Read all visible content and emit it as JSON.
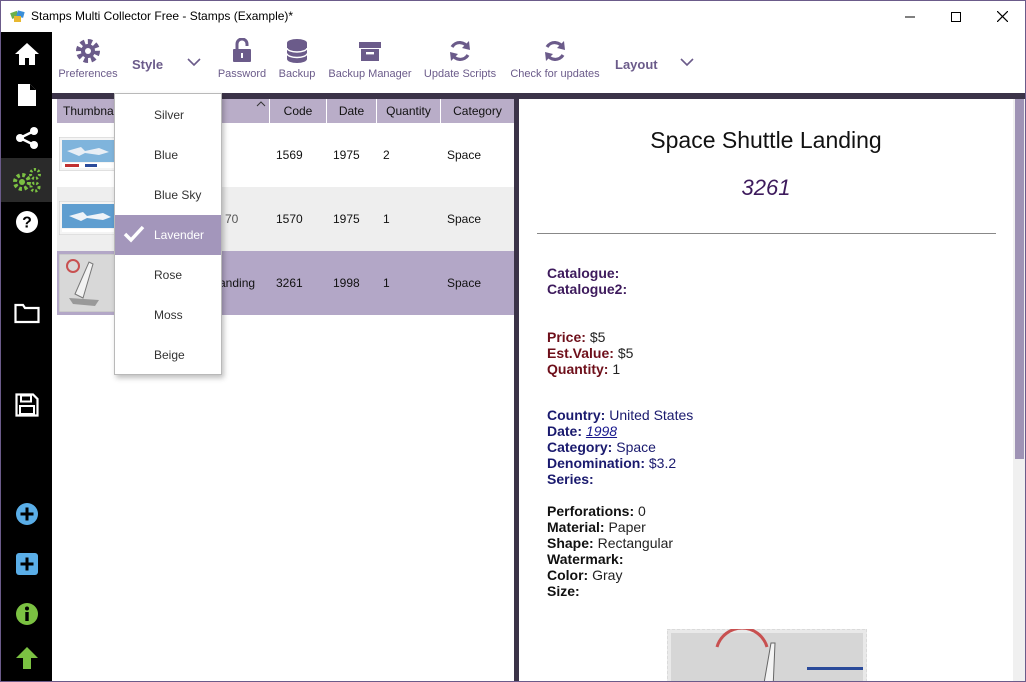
{
  "window": {
    "title": "Stamps Multi Collector Free - Stamps (Example)*"
  },
  "toolbar": {
    "preferences": "Preferences",
    "style": "Style",
    "password": "Password",
    "backup": "Backup",
    "backup_manager": "Backup Manager",
    "update_scripts": "Update Scripts",
    "check_updates": "Check for updates",
    "layout": "Layout"
  },
  "sidebar": {
    "items": [
      "home-icon",
      "document-icon",
      "share-icon",
      "settings-icon",
      "help-icon",
      "folder-icon",
      "save-icon",
      "add-circle-icon",
      "add-square-icon",
      "info-icon",
      "up-arrow-icon"
    ]
  },
  "grid": {
    "columns": [
      "Thumbna",
      "Code",
      "Date",
      "Quantity",
      "Category"
    ],
    "rows": [
      {
        "name": "",
        "code": "1569",
        "date": "1975",
        "quantity": "2",
        "category": "Space"
      },
      {
        "name": "70",
        "code": "1570",
        "date": "1975",
        "quantity": "1",
        "category": "Space"
      },
      {
        "name": "anding",
        "code": "3261",
        "date": "1998",
        "quantity": "1",
        "category": "Space"
      }
    ]
  },
  "style_menu": {
    "items": [
      "Silver",
      "Blue",
      "Blue Sky",
      "Lavender",
      "Rose",
      "Moss",
      "Beige"
    ],
    "selected": "Lavender"
  },
  "detail": {
    "title": "Space Shuttle Landing",
    "code": "3261",
    "catalogue_label": "Catalogue:",
    "catalogue2_label": "Catalogue2:",
    "price_label": "Price:",
    "price": "$5",
    "est_value_label": "Est.Value:",
    "est_value": "$5",
    "quantity_label": "Quantity:",
    "quantity": "1",
    "country_label": "Country:",
    "country": "United States",
    "date_label": "Date:",
    "date": "1998",
    "category_label": "Category:",
    "category": "Space",
    "denomination_label": "Denomination:",
    "denomination": "$3.2",
    "series_label": "Series:",
    "perforations_label": "Perforations:",
    "perforations": "0",
    "material_label": "Material:",
    "material": "Paper",
    "shape_label": "Shape:",
    "shape": "Rectangular",
    "watermark_label": "Watermark:",
    "color_label": "Color:",
    "color": "Gray",
    "size_label": "Size:"
  },
  "colors": {
    "accent": "#6b5b8a",
    "selected_row": "#b3a7c7",
    "header": "#b9adc8"
  }
}
